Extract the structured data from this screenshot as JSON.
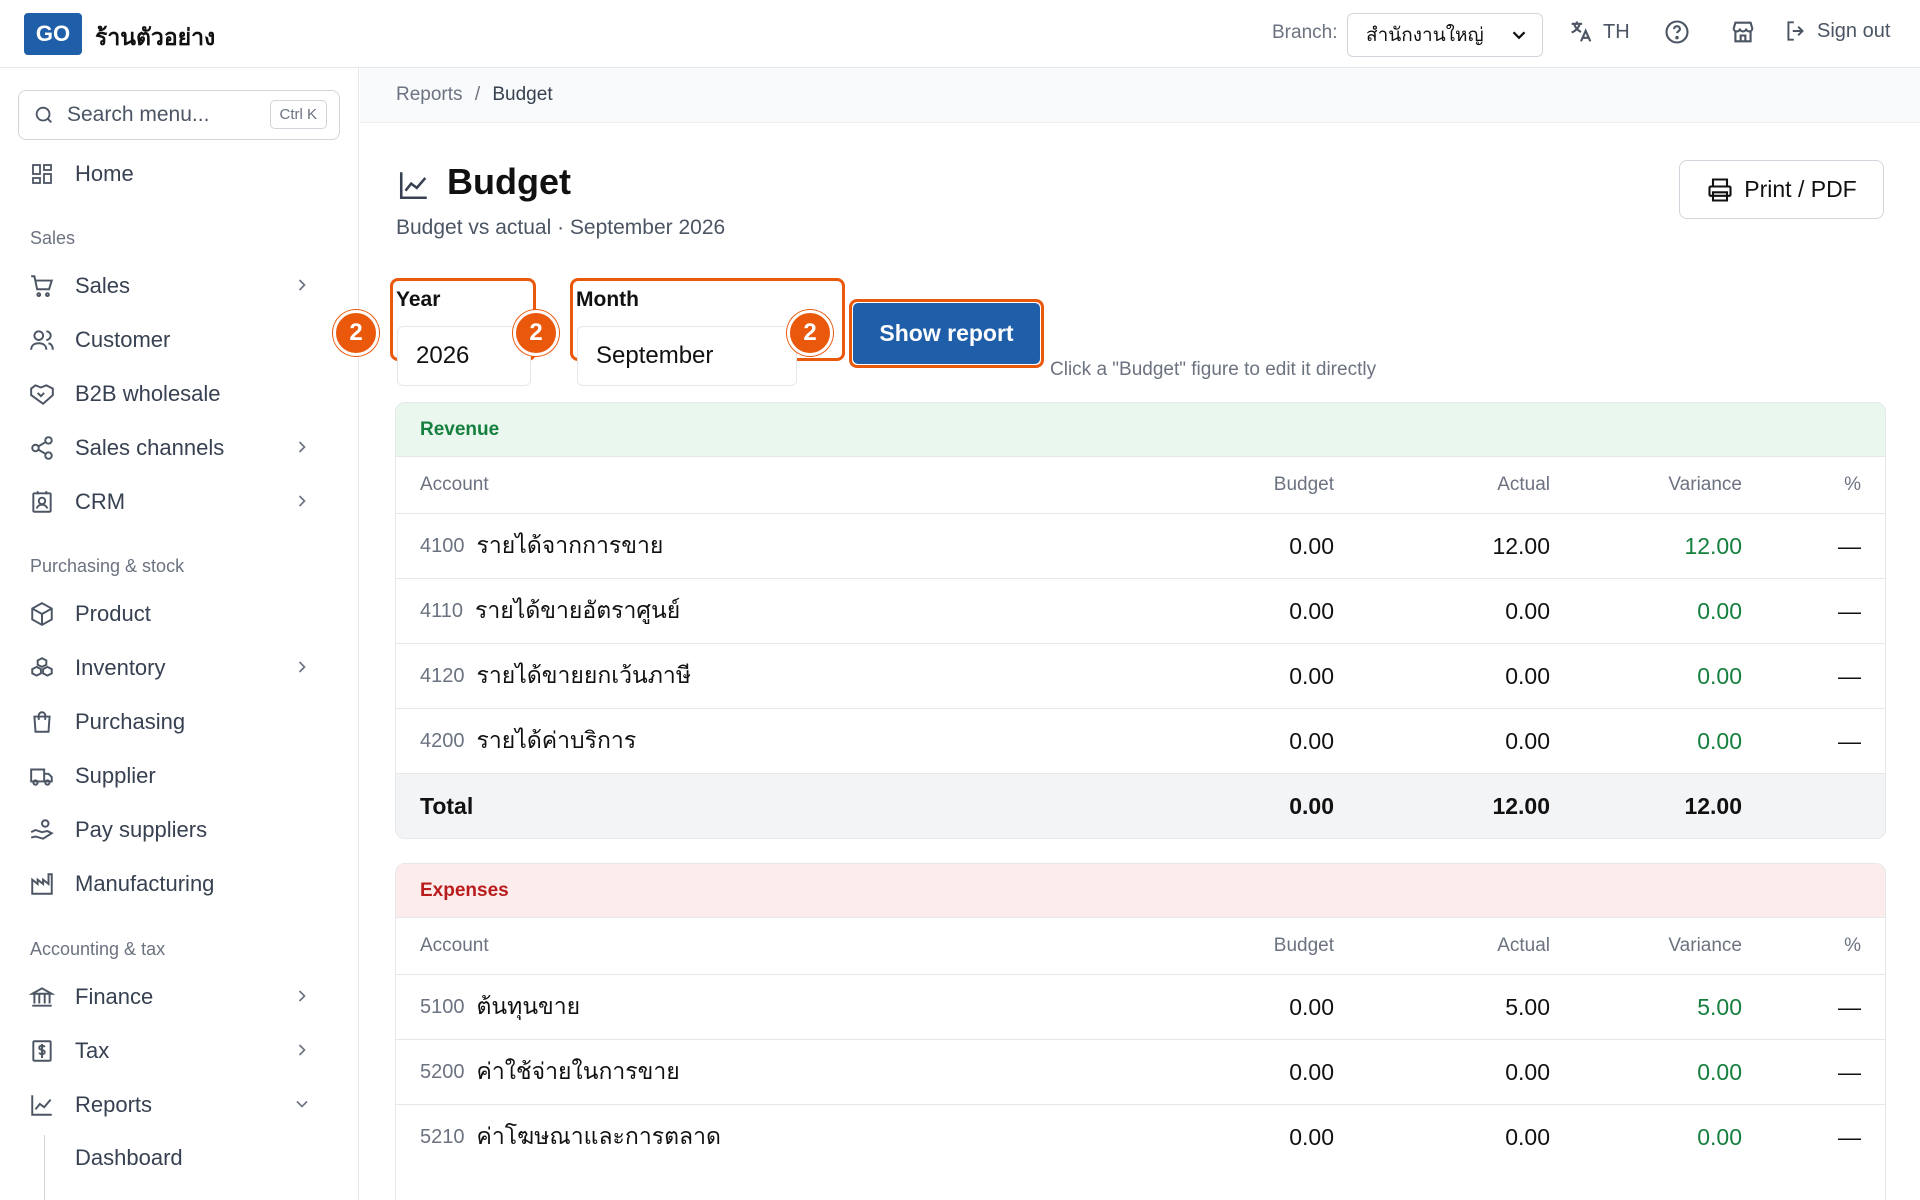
{
  "header": {
    "logo": "GO",
    "shop_name": "ร้านตัวอย่าง",
    "branch_label": "Branch:",
    "branch_value": "สำนักงานใหญ่",
    "language": "TH",
    "sign_out": "Sign out"
  },
  "sidebar": {
    "search_placeholder": "Search menu...",
    "search_shortcut": "Ctrl K",
    "home": "Home",
    "sections": {
      "sales": "Sales",
      "purchasing": "Purchasing & stock",
      "accounting": "Accounting & tax"
    },
    "items": {
      "sales": "Sales",
      "customer": "Customer",
      "b2b": "B2B wholesale",
      "channels": "Sales channels",
      "crm": "CRM",
      "product": "Product",
      "inventory": "Inventory",
      "purchasing": "Purchasing",
      "supplier": "Supplier",
      "pay_suppliers": "Pay suppliers",
      "manufacturing": "Manufacturing",
      "finance": "Finance",
      "tax": "Tax",
      "reports": "Reports",
      "dashboard": "Dashboard"
    }
  },
  "breadcrumb": {
    "parent": "Reports",
    "separator": "/",
    "current": "Budget"
  },
  "page": {
    "title": "Budget",
    "subtitle": "Budget vs actual · September 2026",
    "print_button": "Print / PDF"
  },
  "filters": {
    "year_label": "Year",
    "year_value": "2026",
    "month_label": "Month",
    "month_value": "September",
    "show_button": "Show report",
    "hint": "Click a \"Budget\" figure to edit it directly",
    "badge": "2"
  },
  "columns": {
    "account": "Account",
    "budget": "Budget",
    "actual": "Actual",
    "variance": "Variance",
    "pct": "%"
  },
  "revenue": {
    "title": "Revenue",
    "rows": [
      {
        "code": "4100",
        "name": "รายได้จากการขาย",
        "budget": "0.00",
        "actual": "12.00",
        "variance": "12.00",
        "pct": "—"
      },
      {
        "code": "4110",
        "name": "รายได้ขายอัตราศูนย์",
        "budget": "0.00",
        "actual": "0.00",
        "variance": "0.00",
        "pct": "—"
      },
      {
        "code": "4120",
        "name": "รายได้ขายยกเว้นภาษี",
        "budget": "0.00",
        "actual": "0.00",
        "variance": "0.00",
        "pct": "—"
      },
      {
        "code": "4200",
        "name": "รายได้ค่าบริการ",
        "budget": "0.00",
        "actual": "0.00",
        "variance": "0.00",
        "pct": "—"
      }
    ],
    "total": {
      "label": "Total",
      "budget": "0.00",
      "actual": "12.00",
      "variance": "12.00"
    }
  },
  "expenses": {
    "title": "Expenses",
    "rows": [
      {
        "code": "5100",
        "name": "ต้นทุนขาย",
        "budget": "0.00",
        "actual": "5.00",
        "variance": "5.00",
        "pct": "—"
      },
      {
        "code": "5200",
        "name": "ค่าใช้จ่ายในการขาย",
        "budget": "0.00",
        "actual": "0.00",
        "variance": "0.00",
        "pct": "—"
      },
      {
        "code": "5210",
        "name": "ค่าโฆษณาและการตลาด",
        "budget": "0.00",
        "actual": "0.00",
        "variance": "0.00",
        "pct": "—"
      }
    ]
  },
  "colors": {
    "brand": "#1f5ea8",
    "highlight": "#ea580c",
    "positive": "#15803d",
    "negative": "#b91c1c"
  }
}
